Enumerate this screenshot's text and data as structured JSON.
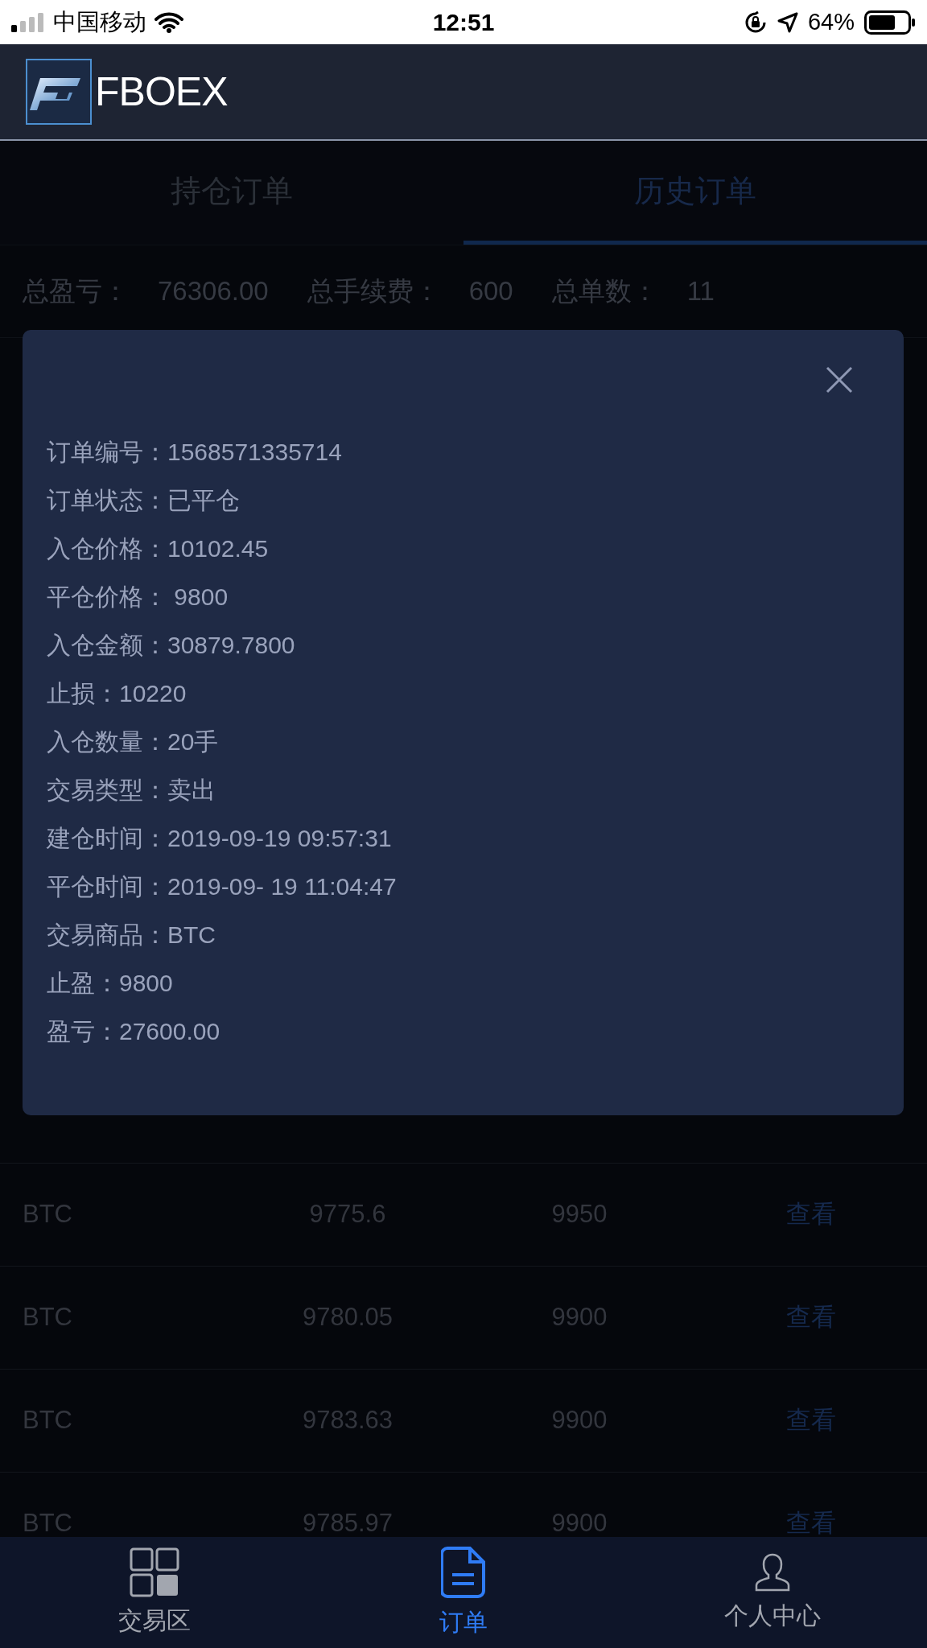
{
  "status_bar": {
    "carrier": "中国移动",
    "time": "12:51",
    "battery": "64%"
  },
  "header": {
    "logo_text": "FBOEX"
  },
  "tabs": [
    {
      "label": "持仓订单",
      "selected": false
    },
    {
      "label": "历史订单",
      "selected": true
    }
  ],
  "summary": [
    {
      "label": "总盈亏：",
      "value": "76306.00"
    },
    {
      "label": "总手续费：",
      "value": "600"
    },
    {
      "label": "总单数：",
      "value": "11"
    }
  ],
  "table": {
    "rows": [
      {
        "cells": [
          "BTC",
          "9775.6",
          "9950"
        ],
        "action": "查看"
      },
      {
        "cells": [
          "BTC",
          "9780.05",
          "9900"
        ],
        "action": "查看"
      },
      {
        "cells": [
          "BTC",
          "9783.63",
          "9900"
        ],
        "action": "查看"
      },
      {
        "cells": [
          "BTC",
          "9785.97",
          "9900"
        ],
        "action": "查看"
      }
    ]
  },
  "dialog": {
    "fields": [
      {
        "label": "订单编号：",
        "value": "1568571335714"
      },
      {
        "label": "订单状态：",
        "value": "已平仓"
      },
      {
        "label": "入仓价格：",
        "value": "10102.45"
      },
      {
        "label": "平仓价格：",
        "value": " 9800"
      },
      {
        "label": "入仓金额：",
        "value": "30879.7800"
      },
      {
        "label": "止损：",
        "value": "10220"
      },
      {
        "label": "入仓数量：",
        "value": "20手"
      },
      {
        "label": "交易类型：",
        "value": "卖出"
      },
      {
        "label": "建仓时间：",
        "value": "2019-09-19 09:57:31"
      },
      {
        "label": "平仓时间：",
        "value": "2019-09- 19 11:04:47"
      },
      {
        "label": "交易商品：",
        "value": "BTC"
      },
      {
        "label": "止盈：",
        "value": "9800"
      },
      {
        "label": "盈亏：",
        "value": "27600.00"
      }
    ]
  },
  "bottom_nav": [
    {
      "label": "交易区",
      "kind": "grid",
      "selected": false
    },
    {
      "label": "订单",
      "kind": "document",
      "selected": true
    },
    {
      "label": "个人中心",
      "kind": "person",
      "selected": false
    }
  ]
}
